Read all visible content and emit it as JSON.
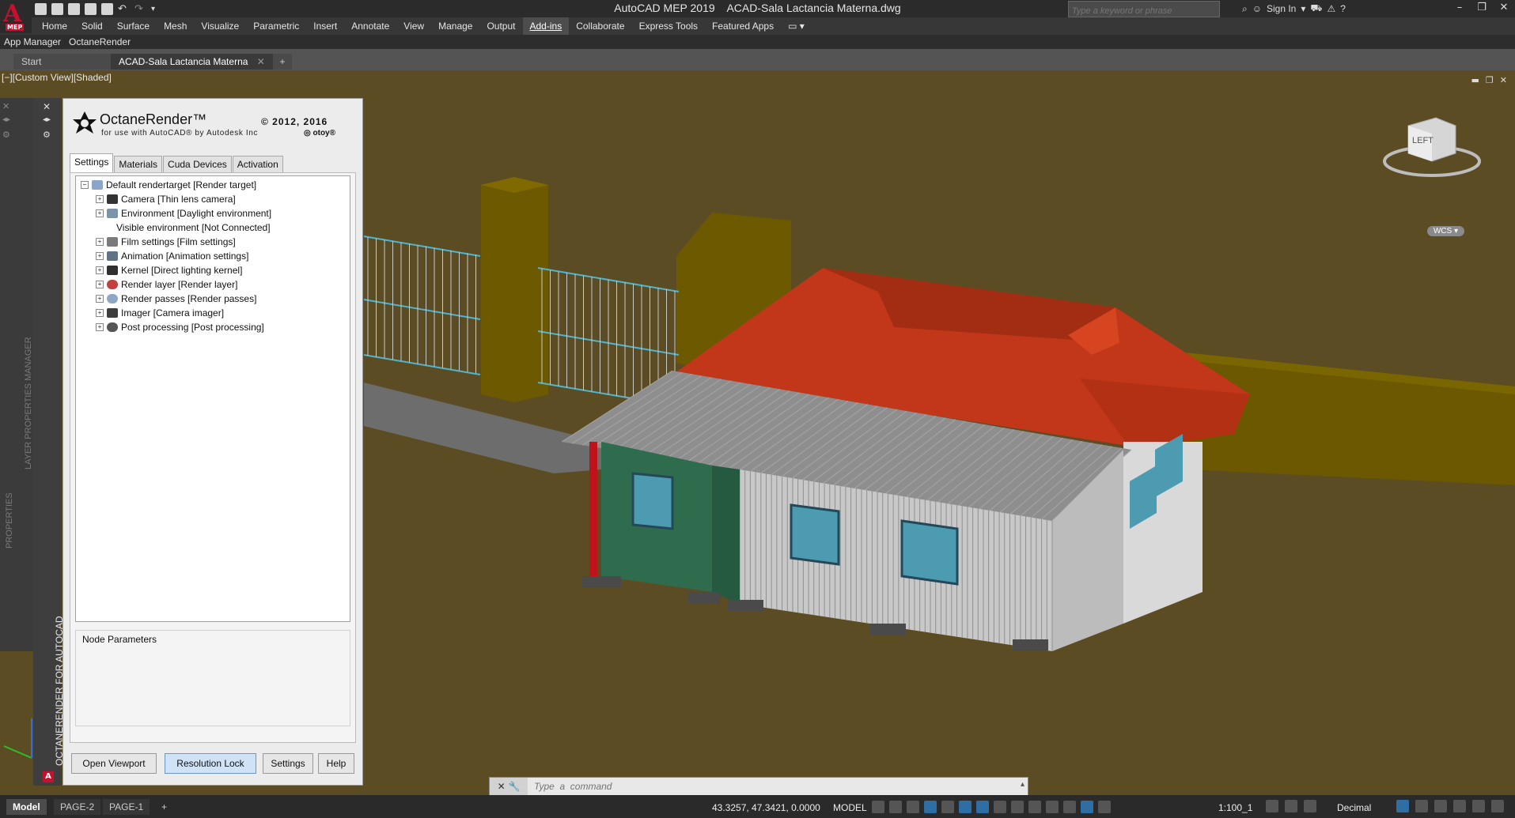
{
  "app": {
    "title": "AutoCAD MEP 2019",
    "filename": "ACAD-Sala Lactancia Materna.dwg",
    "search_placeholder": "Type a keyword or phrase",
    "signin_label": "Sign In",
    "logo_badge": "MEP"
  },
  "ribbon": {
    "tabs": [
      "Home",
      "Solid",
      "Surface",
      "Mesh",
      "Visualize",
      "Parametric",
      "Insert",
      "Annotate",
      "View",
      "Manage",
      "Output",
      "Add-ins",
      "Collaborate",
      "Express Tools",
      "Featured Apps"
    ],
    "active_tab": "Add-ins",
    "panels": [
      "App Manager",
      "OctaneRender"
    ]
  },
  "doc_tabs": {
    "start": "Start",
    "file": "ACAD-Sala Lactancia Materna",
    "add": "+"
  },
  "viewport": {
    "label": "[−][Custom View][Shaded]",
    "viewcube_face": "LEFT",
    "wcs_label": "WCS",
    "colors": {
      "ground": "#5c4c23",
      "wall": "#6d5a00",
      "roof": "#c53b15",
      "corrugated": "#8d8d8d",
      "green_wall": "#2f6b4d",
      "window": "#4c9bb0"
    }
  },
  "side_palettes": {
    "properties": "PROPERTIES",
    "layer_manager": "LAYER PROPERTIES MANAGER",
    "octane_strip": "OCTANERENDER FOR AUTOCAD"
  },
  "octane": {
    "brand": "OctaneRender™",
    "subtitle": "for use with AutoCAD® by Autodesk Inc",
    "copyright": "© 2012, 2016",
    "otoy": "◎ otoy®",
    "tabs": [
      "Settings",
      "Materials",
      "Cuda Devices",
      "Activation"
    ],
    "active_tab": "Settings",
    "tree_root": "Default rendertarget  [Render target]",
    "tree_items": [
      {
        "label": "Camera  [Thin lens camera]",
        "icon": "camera-icon",
        "expandable": true
      },
      {
        "label": "Environment  [Daylight environment]",
        "icon": "environment-icon",
        "expandable": true
      },
      {
        "label": "Visible environment  [Not Connected]",
        "icon": "",
        "expandable": false
      },
      {
        "label": "Film settings  [Film settings]",
        "icon": "film-icon",
        "expandable": true
      },
      {
        "label": "Animation  [Animation settings]",
        "icon": "animation-icon",
        "expandable": true
      },
      {
        "label": "Kernel  [Direct lighting kernel]",
        "icon": "kernel-icon",
        "expandable": true
      },
      {
        "label": "Render layer  [Render layer]",
        "icon": "render-layer-icon",
        "expandable": true
      },
      {
        "label": "Render passes  [Render passes]",
        "icon": "render-passes-icon",
        "expandable": true
      },
      {
        "label": "Imager  [Camera imager]",
        "icon": "imager-icon",
        "expandable": true
      },
      {
        "label": "Post processing  [Post processing]",
        "icon": "post-processing-icon",
        "expandable": true
      }
    ],
    "node_params_title": "Node Parameters",
    "buttons": {
      "open_viewport": "Open Viewport",
      "resolution_lock": "Resolution Lock",
      "settings": "Settings",
      "help": "Help"
    }
  },
  "command_line": {
    "placeholder": "Type  a  command"
  },
  "status": {
    "layout_tabs": [
      "Model",
      "PAGE-2",
      "PAGE-1"
    ],
    "add": "+",
    "coords": "43.3257, 47.3421, 0.0000",
    "model": "MODEL",
    "scale": "1:100_1",
    "units": "Decimal"
  }
}
